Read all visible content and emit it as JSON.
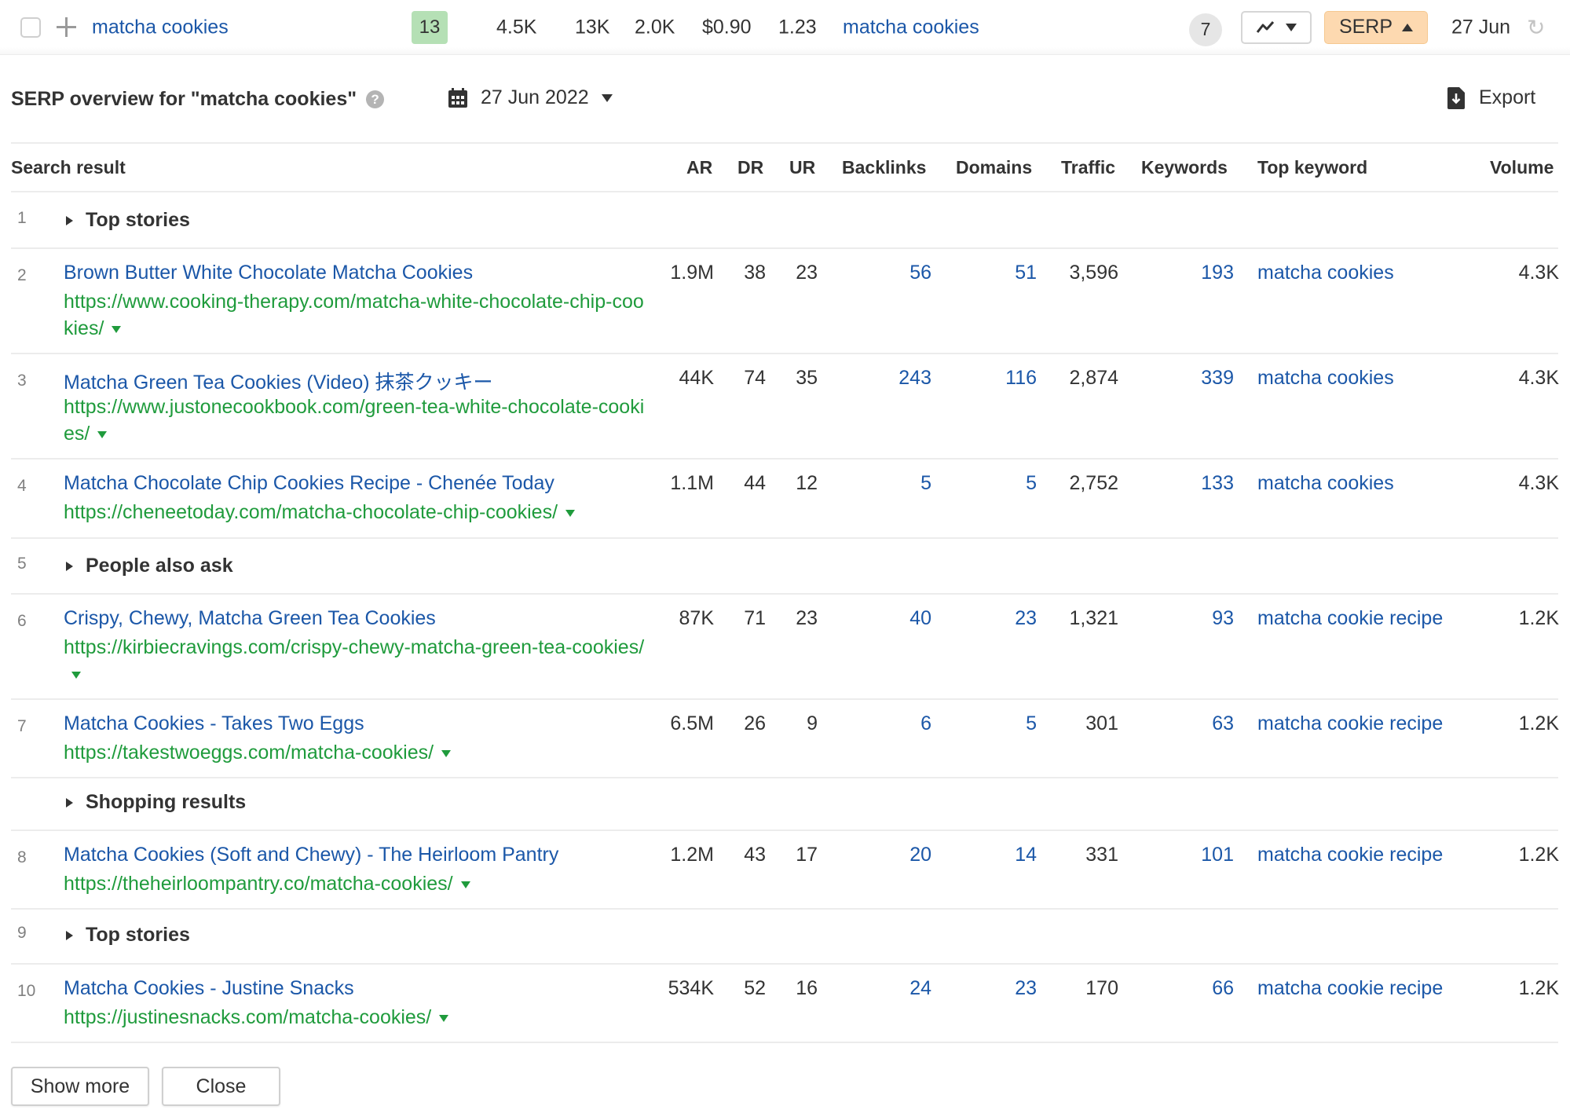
{
  "keyword_row": {
    "keyword": "matcha cookies",
    "kd": "13",
    "volume": "4.5K",
    "global_volume": "13K",
    "traffic_potential": "2.0K",
    "cpc": "$0.90",
    "cps": "1.23",
    "parent_topic": "matcha cookies",
    "serp_features_count": "7",
    "serp_button": "SERP",
    "updated": "27 Jun",
    "colors": {
      "kd_badge": "#b5e0b5",
      "serp_button": "#fdd9b0",
      "link": "#1b57a8",
      "url": "#1f9b3c"
    }
  },
  "panel": {
    "title": "SERP overview for \"matcha cookies\"",
    "date": "27 Jun 2022",
    "export_label": "Export"
  },
  "columns": [
    "Search result",
    "AR",
    "DR",
    "UR",
    "Backlinks",
    "Domains",
    "Traffic",
    "Keywords",
    "Top keyword",
    "Volume"
  ],
  "rows": [
    {
      "pos": "1",
      "type": "feature",
      "label": "Top stories"
    },
    {
      "pos": "2",
      "type": "result",
      "title": "Brown Butter White Chocolate Matcha Cookies",
      "url": "https://www.cooking-therapy.com/matcha-white-chocolate-chip-cookies/",
      "ar": "1.9M",
      "dr": "38",
      "ur": "23",
      "backlinks": "56",
      "domains": "51",
      "traffic": "3,596",
      "keywords": "193",
      "top_keyword": "matcha cookies",
      "volume": "4.3K"
    },
    {
      "pos": "3",
      "type": "result",
      "title": "Matcha Green Tea Cookies (Video) 抹茶クッキー",
      "url": "https://www.justonecookbook.com/green-tea-white-chocolate-cookies/",
      "ar": "44K",
      "dr": "74",
      "ur": "35",
      "backlinks": "243",
      "domains": "116",
      "traffic": "2,874",
      "keywords": "339",
      "top_keyword": "matcha cookies",
      "volume": "4.3K"
    },
    {
      "pos": "4",
      "type": "result",
      "title": "Matcha Chocolate Chip Cookies Recipe - Chenée Today",
      "url": "https://cheneetoday.com/matcha-chocolate-chip-cookies/",
      "ar": "1.1M",
      "dr": "44",
      "ur": "12",
      "backlinks": "5",
      "domains": "5",
      "traffic": "2,752",
      "keywords": "133",
      "top_keyword": "matcha cookies",
      "volume": "4.3K"
    },
    {
      "pos": "5",
      "type": "feature",
      "label": "People also ask"
    },
    {
      "pos": "6",
      "type": "result",
      "title": "Crispy, Chewy, Matcha Green Tea Cookies",
      "url": "https://kirbiecravings.com/crispy-chewy-matcha-green-tea-cookies/",
      "ar": "87K",
      "dr": "71",
      "ur": "23",
      "backlinks": "40",
      "domains": "23",
      "traffic": "1,321",
      "keywords": "93",
      "top_keyword": "matcha cookie recipe",
      "volume": "1.2K"
    },
    {
      "pos": "7",
      "type": "result",
      "title": "Matcha Cookies - Takes Two Eggs",
      "url": "https://takestwoeggs.com/matcha-cookies/",
      "ar": "6.5M",
      "dr": "26",
      "ur": "9",
      "backlinks": "6",
      "domains": "5",
      "traffic": "301",
      "keywords": "63",
      "top_keyword": "matcha cookie recipe",
      "volume": "1.2K"
    },
    {
      "pos": "",
      "type": "feature",
      "label": "Shopping results"
    },
    {
      "pos": "8",
      "type": "result",
      "title": "Matcha Cookies (Soft and Chewy) - The Heirloom Pantry",
      "url": "https://theheirloompantry.co/matcha-cookies/",
      "ar": "1.2M",
      "dr": "43",
      "ur": "17",
      "backlinks": "20",
      "domains": "14",
      "traffic": "331",
      "keywords": "101",
      "top_keyword": "matcha cookie recipe",
      "volume": "1.2K"
    },
    {
      "pos": "9",
      "type": "feature",
      "label": "Top stories"
    },
    {
      "pos": "10",
      "type": "result",
      "title": "Matcha Cookies - Justine Snacks",
      "url": "https://justinesnacks.com/matcha-cookies/",
      "ar": "534K",
      "dr": "52",
      "ur": "16",
      "backlinks": "24",
      "domains": "23",
      "traffic": "170",
      "keywords": "66",
      "top_keyword": "matcha cookie recipe",
      "volume": "1.2K"
    }
  ],
  "footer": {
    "show_more": "Show more",
    "close": "Close"
  }
}
